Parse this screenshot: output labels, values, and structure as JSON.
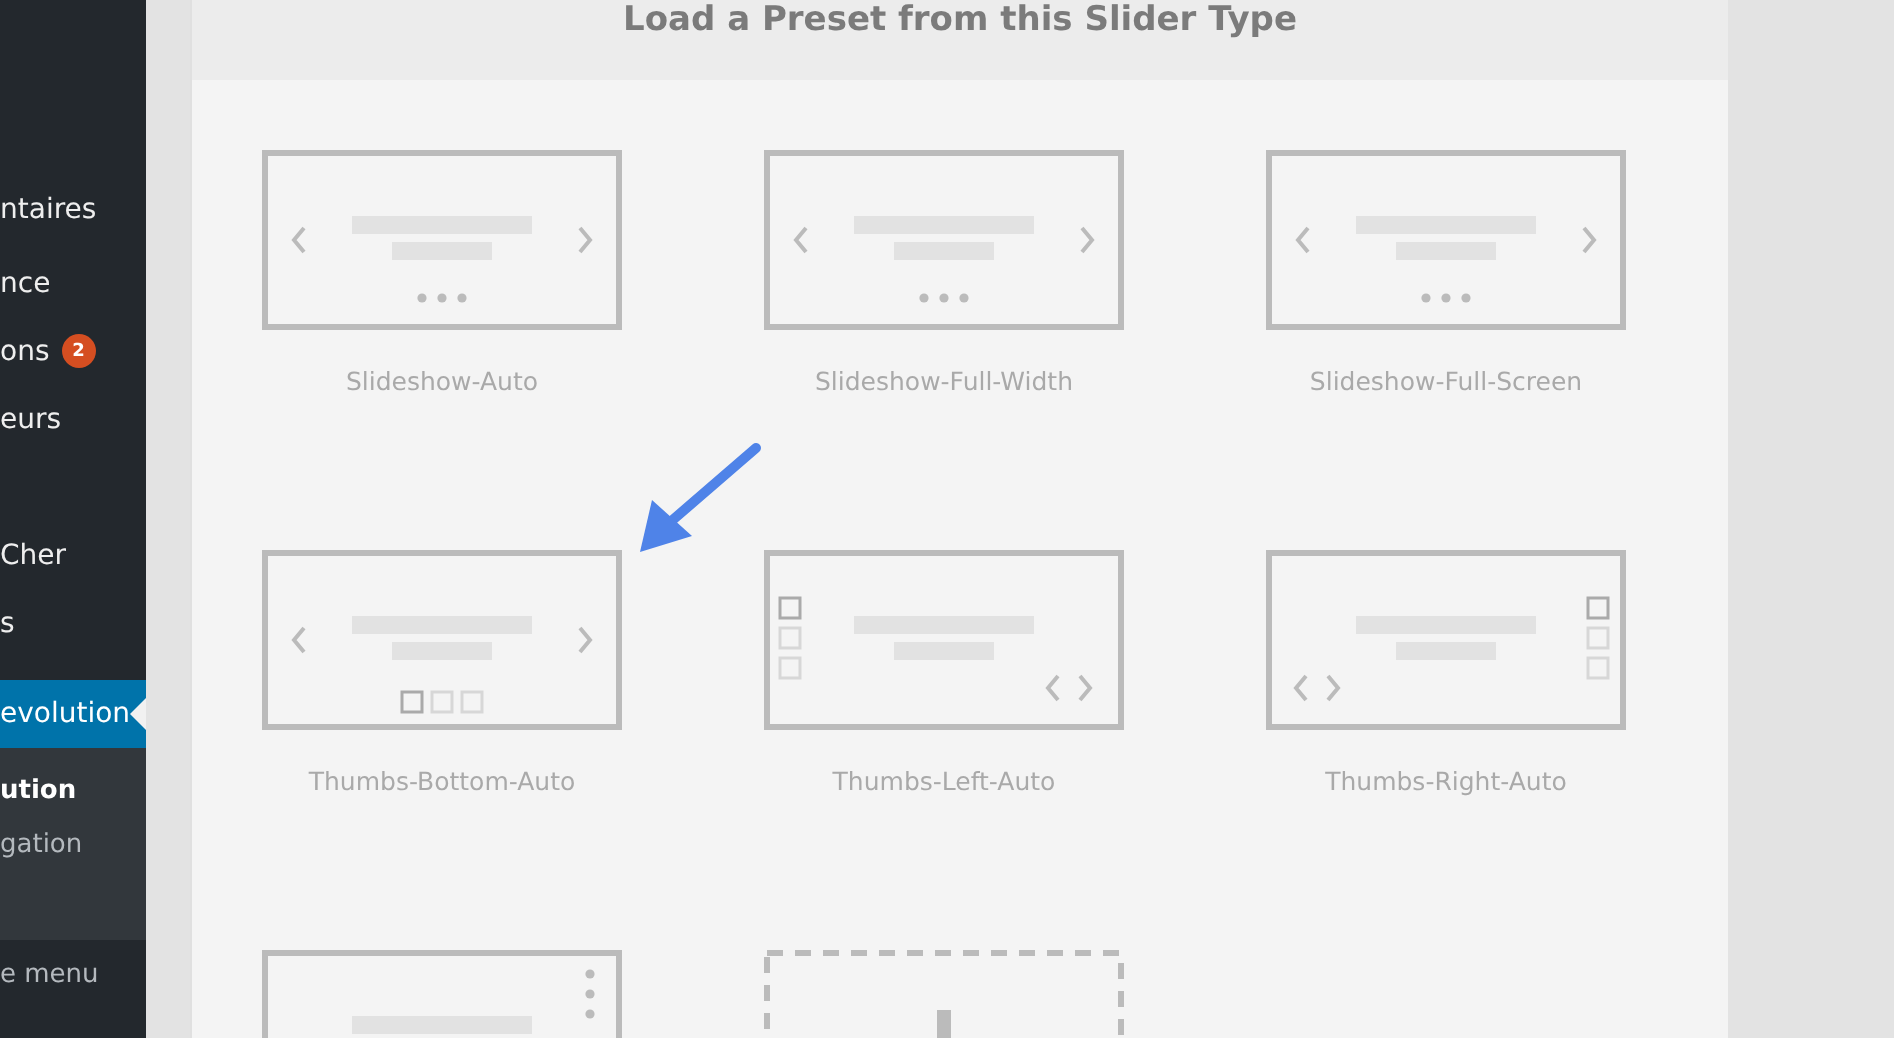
{
  "sidebar": {
    "items": [
      {
        "label": "ntaires",
        "selected": false
      },
      {
        "label": "nce",
        "selected": false
      },
      {
        "label": "ons",
        "badge": "2",
        "selected": false
      },
      {
        "label": "eurs",
        "selected": false
      },
      {
        "label": "Cher",
        "selected": false
      },
      {
        "label": "s",
        "selected": false
      },
      {
        "label": "evolution",
        "selected": true,
        "children": [
          {
            "label": "ution",
            "selected": true
          },
          {
            "label": "gation",
            "selected": false
          }
        ]
      }
    ],
    "collapse": "e menu"
  },
  "dialog": {
    "title": "Load a Preset from this Slider Type",
    "presets": [
      {
        "kind": "arrows-dots",
        "label": "Slideshow-Auto"
      },
      {
        "kind": "arrows-dots",
        "label": "Slideshow-Full-Width"
      },
      {
        "kind": "arrows-dots",
        "label": "Slideshow-Full-Screen"
      },
      {
        "kind": "thumbs-bottom",
        "label": "Thumbs-Bottom-Auto"
      },
      {
        "kind": "thumbs-left",
        "label": "Thumbs-Left-Auto"
      },
      {
        "kind": "thumbs-right",
        "label": "Thumbs-Right-Auto"
      },
      {
        "kind": "vertical-dots"
      },
      {
        "kind": "add"
      }
    ]
  }
}
